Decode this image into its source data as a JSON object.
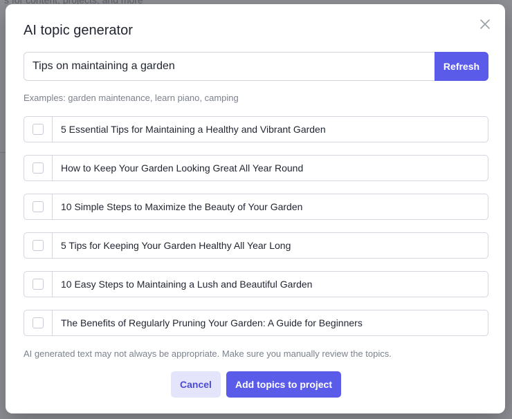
{
  "background": {
    "top_text": "s for content, projects, and more"
  },
  "modal": {
    "title": "AI topic generator",
    "close_icon": "close-icon",
    "search": {
      "value": "Tips on maintaining a garden",
      "refresh_label": "Refresh"
    },
    "examples_text": "Examples: garden maintenance, learn piano, camping",
    "topics": [
      {
        "label": "5 Essential Tips for Maintaining a Healthy and Vibrant Garden",
        "checked": false
      },
      {
        "label": "How to Keep Your Garden Looking Great All Year Round",
        "checked": false
      },
      {
        "label": "10 Simple Steps to Maximize the Beauty of Your Garden",
        "checked": false
      },
      {
        "label": "5 Tips for Keeping Your Garden Healthy All Year Long",
        "checked": false
      },
      {
        "label": "10 Easy Steps to Maintaining a Lush and Beautiful Garden",
        "checked": false
      },
      {
        "label": "The Benefits of Regularly Pruning Your Garden: A Guide for Beginners",
        "checked": false
      }
    ],
    "disclaimer": "AI generated text may not always be appropriate. Make sure you manually review the topics.",
    "cancel_label": "Cancel",
    "add_label": "Add topics to project"
  },
  "colors": {
    "accent": "#5b5bea",
    "cancel_bg": "#e4e5fb",
    "overlay": "#8d8f95"
  }
}
